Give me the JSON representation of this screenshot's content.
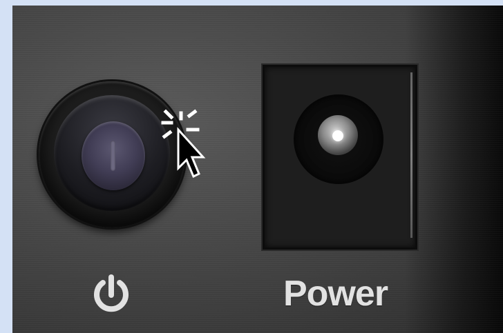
{
  "panel": {
    "power_button_icon": "power-icon",
    "power_label": "Power",
    "power_jack_icon": "dc-power-jack"
  },
  "cursor": {
    "icon": "arrow-cursor-with-click-indicator"
  },
  "colors": {
    "frame_background": "#d4e1f5",
    "panel_surface": "#474747",
    "label_text": "#e2e2e2",
    "button_cap": "#413d55"
  }
}
